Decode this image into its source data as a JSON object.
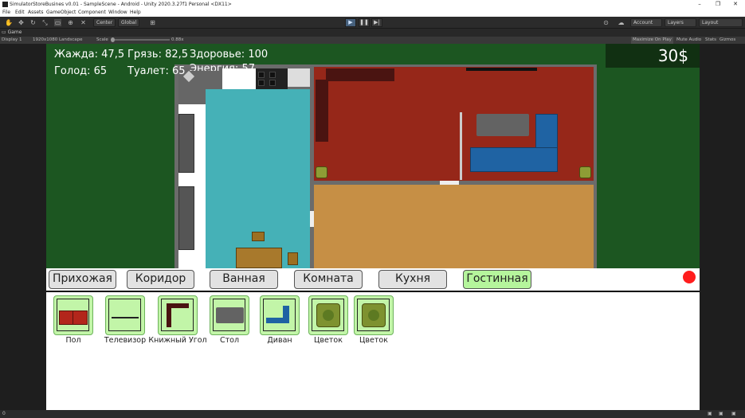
{
  "window": {
    "title": "SimulatorStoreBusines v0.01 - SampleScene - Android - Unity 2020.3.27f1 Personal <DX11>",
    "controls": [
      "–",
      "❐",
      "✕"
    ]
  },
  "menu": [
    "File",
    "Edit",
    "Assets",
    "GameObject",
    "Component",
    "Window",
    "Help"
  ],
  "toolbar": {
    "pivot": "Center",
    "space": "Global",
    "account": "Account",
    "layers": "Layers",
    "layout": "Layout"
  },
  "game_tab": {
    "label": "Game",
    "display": "Display 1",
    "resolution": "1920x1080 Landscape",
    "scale_label": "Scale",
    "scale_value": "0.88x",
    "maximize": "Maximize On Play",
    "mute": "Mute Audio",
    "stats": "Stats",
    "gizmos": "Gizmos"
  },
  "hud": {
    "thirst": "Жажда: 47,5",
    "dirt": "Грязь: 82,5",
    "health": "Здоровье: 100",
    "hunger": "Голод: 65",
    "toilet": "Туалет: 65",
    "energy": "Энергия: 57",
    "money": "30$"
  },
  "rooms": [
    {
      "label": "Прихожая",
      "active": false
    },
    {
      "label": "Коридор",
      "active": false
    },
    {
      "label": "Ванная",
      "active": false
    },
    {
      "label": "Комната",
      "active": false
    },
    {
      "label": "Кухня",
      "active": false
    },
    {
      "label": "Гостинная",
      "active": true
    }
  ],
  "items": [
    {
      "label": "Пол",
      "icon": "floor-icon"
    },
    {
      "label": "Телевизор",
      "icon": "tv-icon"
    },
    {
      "label": "Книжный Угол",
      "icon": "bookshelf-corner-icon"
    },
    {
      "label": "Стол",
      "icon": "table-icon"
    },
    {
      "label": "Диван",
      "icon": "sofa-icon"
    },
    {
      "label": "Цветок",
      "icon": "flower-icon"
    },
    {
      "label": "Цветок",
      "icon": "flower-icon"
    }
  ],
  "status": {
    "left": "0"
  },
  "colors": {
    "game_bg": "#1c5621",
    "active_tab": "#b5f59c",
    "item_bg": "#c2f5a8",
    "record": "#ff1d1d"
  }
}
